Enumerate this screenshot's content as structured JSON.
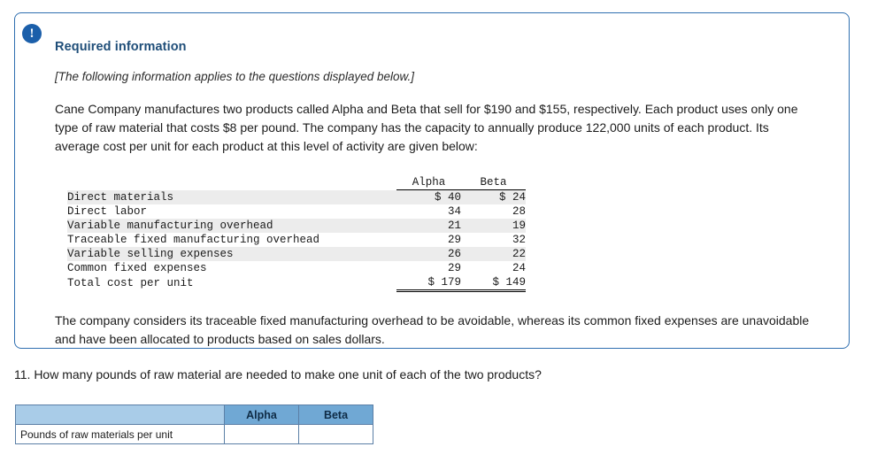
{
  "card": {
    "badge_icon": "!",
    "title": "Required information",
    "note": "[The following information applies to the questions displayed below.]",
    "paragraph": "Cane Company manufactures two products called Alpha and Beta that sell for $190 and $155, respectively. Each product uses only one type of raw material that costs $8 per pound. The company has the capacity to annually produce 122,000 units of each product. Its average cost per unit for each product at this level of activity are given below:",
    "closing": "The company considers its traceable fixed manufacturing overhead to be avoidable, whereas its common fixed expenses are unavoidable and have been allocated to products based on sales dollars."
  },
  "cost_table": {
    "headers": [
      "",
      "Alpha",
      "Beta"
    ],
    "rows": [
      {
        "label": "Direct materials",
        "alpha": "$ 40",
        "beta": "$ 24",
        "shaded": true
      },
      {
        "label": "Direct labor",
        "alpha": "34",
        "beta": "28",
        "shaded": false
      },
      {
        "label": "Variable manufacturing overhead",
        "alpha": "21",
        "beta": "19",
        "shaded": true
      },
      {
        "label": "Traceable fixed manufacturing overhead",
        "alpha": "29",
        "beta": "32",
        "shaded": false
      },
      {
        "label": "Variable selling expenses",
        "alpha": "26",
        "beta": "22",
        "shaded": true
      },
      {
        "label": "Common fixed expenses",
        "alpha": "29",
        "beta": "24",
        "shaded": false
      }
    ],
    "total": {
      "label": "Total cost per unit",
      "alpha": "$ 179",
      "beta": "$ 149"
    }
  },
  "question": {
    "text": "11. How many pounds of raw material are needed to make one unit of each of the two products?"
  },
  "answer_table": {
    "col_blank": "",
    "col_alpha": "Alpha",
    "col_beta": "Beta",
    "row_label": "Pounds of raw materials per unit",
    "alpha_value": "",
    "beta_value": ""
  },
  "colors": {
    "card_border": "#2f6fb0",
    "title": "#1f4e79",
    "header_fill": "#70a8d4",
    "header_blank_fill": "#a9cce8",
    "badge": "#1b5faa"
  }
}
